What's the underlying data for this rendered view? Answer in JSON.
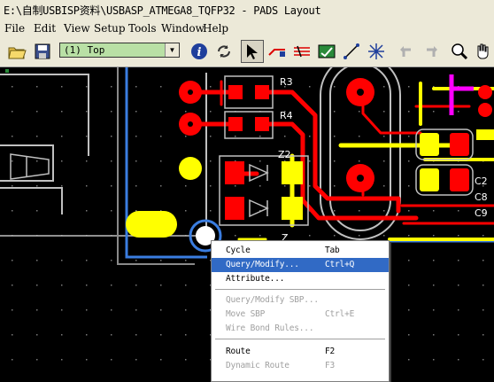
{
  "window": {
    "title": "E:\\自制USBISP资料\\USBASP_ATMEGA8_TQFP32 - PADS Layout"
  },
  "menu": {
    "items": [
      "File",
      "Edit",
      "View",
      "Setup",
      "Tools",
      "Window",
      "Help"
    ]
  },
  "toolbar": {
    "layer_value": "(1) Top",
    "layer_color": "#b9e0a5",
    "icons": [
      "open-folder-icon",
      "save-icon",
      "info-icon",
      "refresh-icon",
      "select-arrow-icon",
      "route-icon",
      "diff-pair-icon",
      "drc-icon",
      "line-icon",
      "cross-icon",
      "undo-icon",
      "redo-icon",
      "zoom-icon",
      "pan-icon"
    ]
  },
  "pcb": {
    "labels": {
      "r3": "R3",
      "r4": "R4",
      "z2": "Z2",
      "c2": "C2",
      "c8": "C8",
      "c9": "C9",
      "z_partial": "Z"
    },
    "colors": {
      "top_copper": "#ff0000",
      "bottom_copper": "#ffff00",
      "outline": "#c0c0c0",
      "board": "#3a7de0",
      "highlight": "#ff00ff"
    }
  },
  "context_menu": {
    "items": [
      {
        "label": "Cycle",
        "shortcut": "Tab",
        "state": "normal"
      },
      {
        "label": "Query/Modify...",
        "shortcut": "Ctrl+Q",
        "state": "highlight"
      },
      {
        "label": "Attribute...",
        "shortcut": "",
        "state": "normal"
      },
      {
        "label": "Query/Modify SBP...",
        "shortcut": "",
        "state": "disabled"
      },
      {
        "label": "Move SBP",
        "shortcut": "Ctrl+E",
        "state": "disabled"
      },
      {
        "label": "Wire Bond Rules...",
        "shortcut": "",
        "state": "disabled"
      },
      {
        "label": "Route",
        "shortcut": "F2",
        "state": "normal"
      },
      {
        "label": "Dynamic Route",
        "shortcut": "F3",
        "state": "disabled"
      }
    ]
  }
}
